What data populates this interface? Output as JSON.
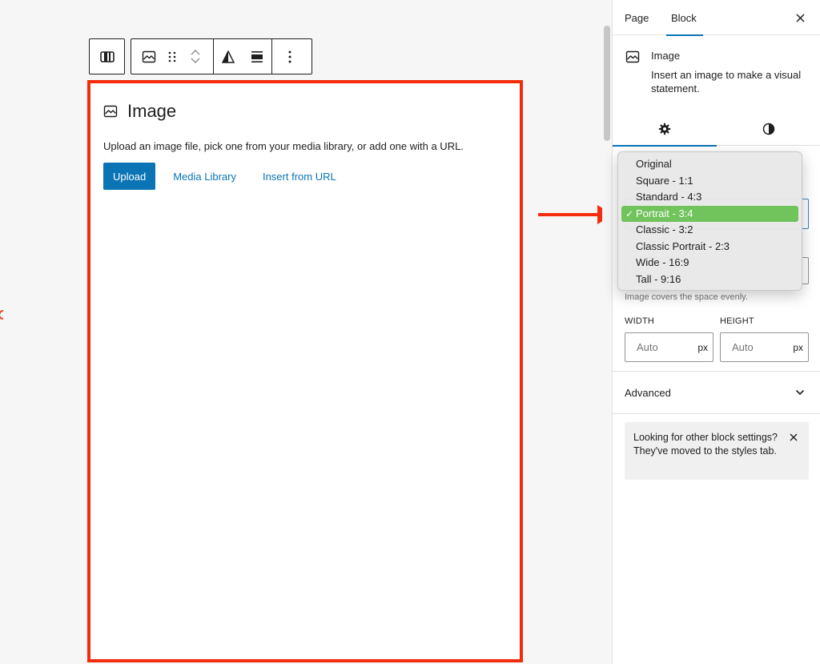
{
  "toolbar": {
    "icons": [
      "block-type-icon",
      "image-icon",
      "drag-handle-icon",
      "move-up-icon",
      "move-down-icon",
      "duotone-icon",
      "align-icon",
      "more-options-icon"
    ]
  },
  "placeholder": {
    "title": "Image",
    "description": "Upload an image file, pick one from your media library, or add one with a URL.",
    "upload_label": "Upload",
    "media_library_label": "Media Library",
    "insert_url_label": "Insert from URL"
  },
  "sidebar": {
    "tabs": [
      {
        "label": "Page",
        "active": false
      },
      {
        "label": "Block",
        "active": true
      }
    ],
    "block": {
      "name": "Image",
      "description": "Insert an image to make a visual statement."
    },
    "help_text": "Image covers the space evenly.",
    "width": {
      "label": "WIDTH",
      "placeholder": "Auto",
      "unit": "px"
    },
    "height": {
      "label": "HEIGHT",
      "placeholder": "Auto",
      "unit": "px"
    },
    "advanced_label": "Advanced",
    "notice": "Looking for other block settings? They've moved to the styles tab."
  },
  "aspect_ratio_menu": {
    "options": [
      "Original",
      "Square - 1:1",
      "Standard - 4:3",
      "Portrait - 3:4",
      "Classic - 3:2",
      "Classic Portrait - 2:3",
      "Wide - 16:9",
      "Tall - 9:16"
    ],
    "selected": "Portrait - 3:4",
    "check_mark": "✓"
  },
  "colors": {
    "accent": "#0a74b5",
    "annotation": "#f42c0c",
    "selected_option": "#71c35c"
  }
}
